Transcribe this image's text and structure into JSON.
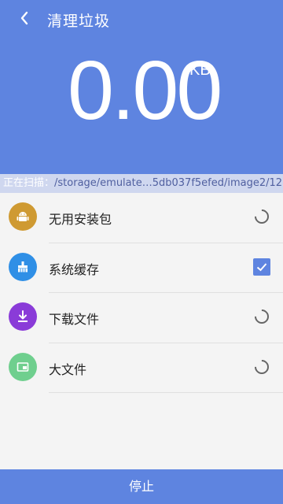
{
  "header": {
    "title": "清理垃圾",
    "size_value": "0.00",
    "size_unit": "KB"
  },
  "scan": {
    "label": "正在扫描：",
    "path": "/storage/emulate…5db037f5efed/image2/12"
  },
  "categories": [
    {
      "label": "无用安装包",
      "icon": "android-icon",
      "color": "#cf9a32",
      "state": "scanning"
    },
    {
      "label": "系统缓存",
      "icon": "broom-icon",
      "color": "#2f8fe6",
      "state": "checked"
    },
    {
      "label": "下载文件",
      "icon": "download-icon",
      "color": "#8a3bd8",
      "state": "scanning"
    },
    {
      "label": "大文件",
      "icon": "folder-icon",
      "color": "#6fcf8e",
      "state": "scanning"
    }
  ],
  "footer": {
    "stop_label": "停止"
  },
  "colors": {
    "primary": "#5e84e0"
  }
}
